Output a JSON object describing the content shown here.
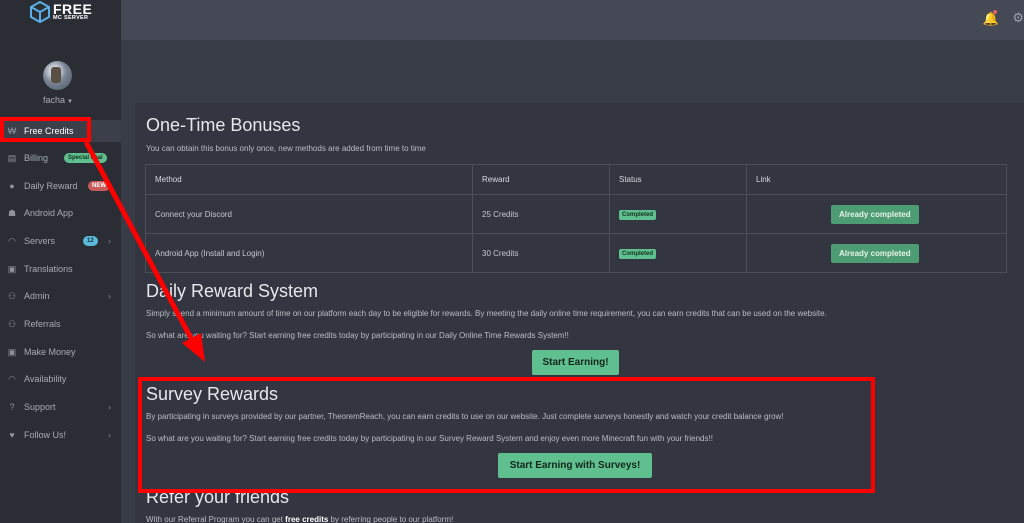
{
  "brand": {
    "name": "FREE",
    "sub": "MC SERVER"
  },
  "user": {
    "name": "facha"
  },
  "sidebar": {
    "items": [
      {
        "label": "Free Credits",
        "icon": "coins-icon",
        "glyph": "₩"
      },
      {
        "label": "Billing",
        "icon": "card-icon",
        "glyph": "▤",
        "badge": "Special deal"
      },
      {
        "label": "Daily Reward",
        "icon": "clock-icon",
        "glyph": "●",
        "badge": "NEW"
      },
      {
        "label": "Android App",
        "icon": "android-icon",
        "glyph": "☗"
      },
      {
        "label": "Servers",
        "icon": "gauge-icon",
        "glyph": "◠",
        "badge": "12"
      },
      {
        "label": "Translations",
        "icon": "translate-icon",
        "glyph": "▣"
      },
      {
        "label": "Admin",
        "icon": "users-gear-icon",
        "glyph": "⚇"
      },
      {
        "label": "Referrals",
        "icon": "people-icon",
        "glyph": "⚇"
      },
      {
        "label": "Make Money",
        "icon": "money-icon",
        "glyph": "▣"
      },
      {
        "label": "Availability",
        "icon": "wifi-icon",
        "glyph": "◠"
      },
      {
        "label": "Support",
        "icon": "question-icon",
        "glyph": "?"
      },
      {
        "label": "Follow Us!",
        "icon": "heart-icon",
        "glyph": "♥"
      }
    ]
  },
  "onetime": {
    "title": "One-Time Bonuses",
    "desc": "You can obtain this bonus only once, new methods are added from time to time",
    "headers": [
      "Method",
      "Reward",
      "Status",
      "Link"
    ],
    "rows": [
      {
        "method": "Connect your Discord",
        "reward": "25 Credits",
        "status": "Completed",
        "link": "Already completed"
      },
      {
        "method": "Android App (Install and Login)",
        "reward": "30 Credits",
        "status": "Completed",
        "link": "Already completed"
      }
    ]
  },
  "daily": {
    "title": "Daily Reward System",
    "p1": "Simply spend a minimum amount of time on our platform each day to be eligible for rewards. By meeting the daily online time requirement, you can earn credits that can be used on the website.",
    "p2": "So what are you waiting for? Start earning free credits today by participating in our Daily Online Time Rewards System!!",
    "button": "Start Earning!"
  },
  "survey": {
    "title": "Survey Rewards",
    "p1": "By participating in surveys provided by our partner, TheoremReach, you can earn credits to use on our website. Just complete surveys honestly and watch your credit balance grow!",
    "p2": "So what are you waiting for? Start earning free credits today by participating in our Survey Reward System and enjoy even more Minecraft fun with your friends!!",
    "button": "Start Earning with Surveys!"
  },
  "refer": {
    "title": "Refer your friends",
    "p_before": "With our Referral Program you can get ",
    "p_bold": "free credits",
    "p_after": " by referring people to our platform!"
  },
  "colors": {
    "accent": "#5fbf8e",
    "annotation": "#ff0000",
    "sidebar": "#2a2d34",
    "panel": "#333640"
  }
}
